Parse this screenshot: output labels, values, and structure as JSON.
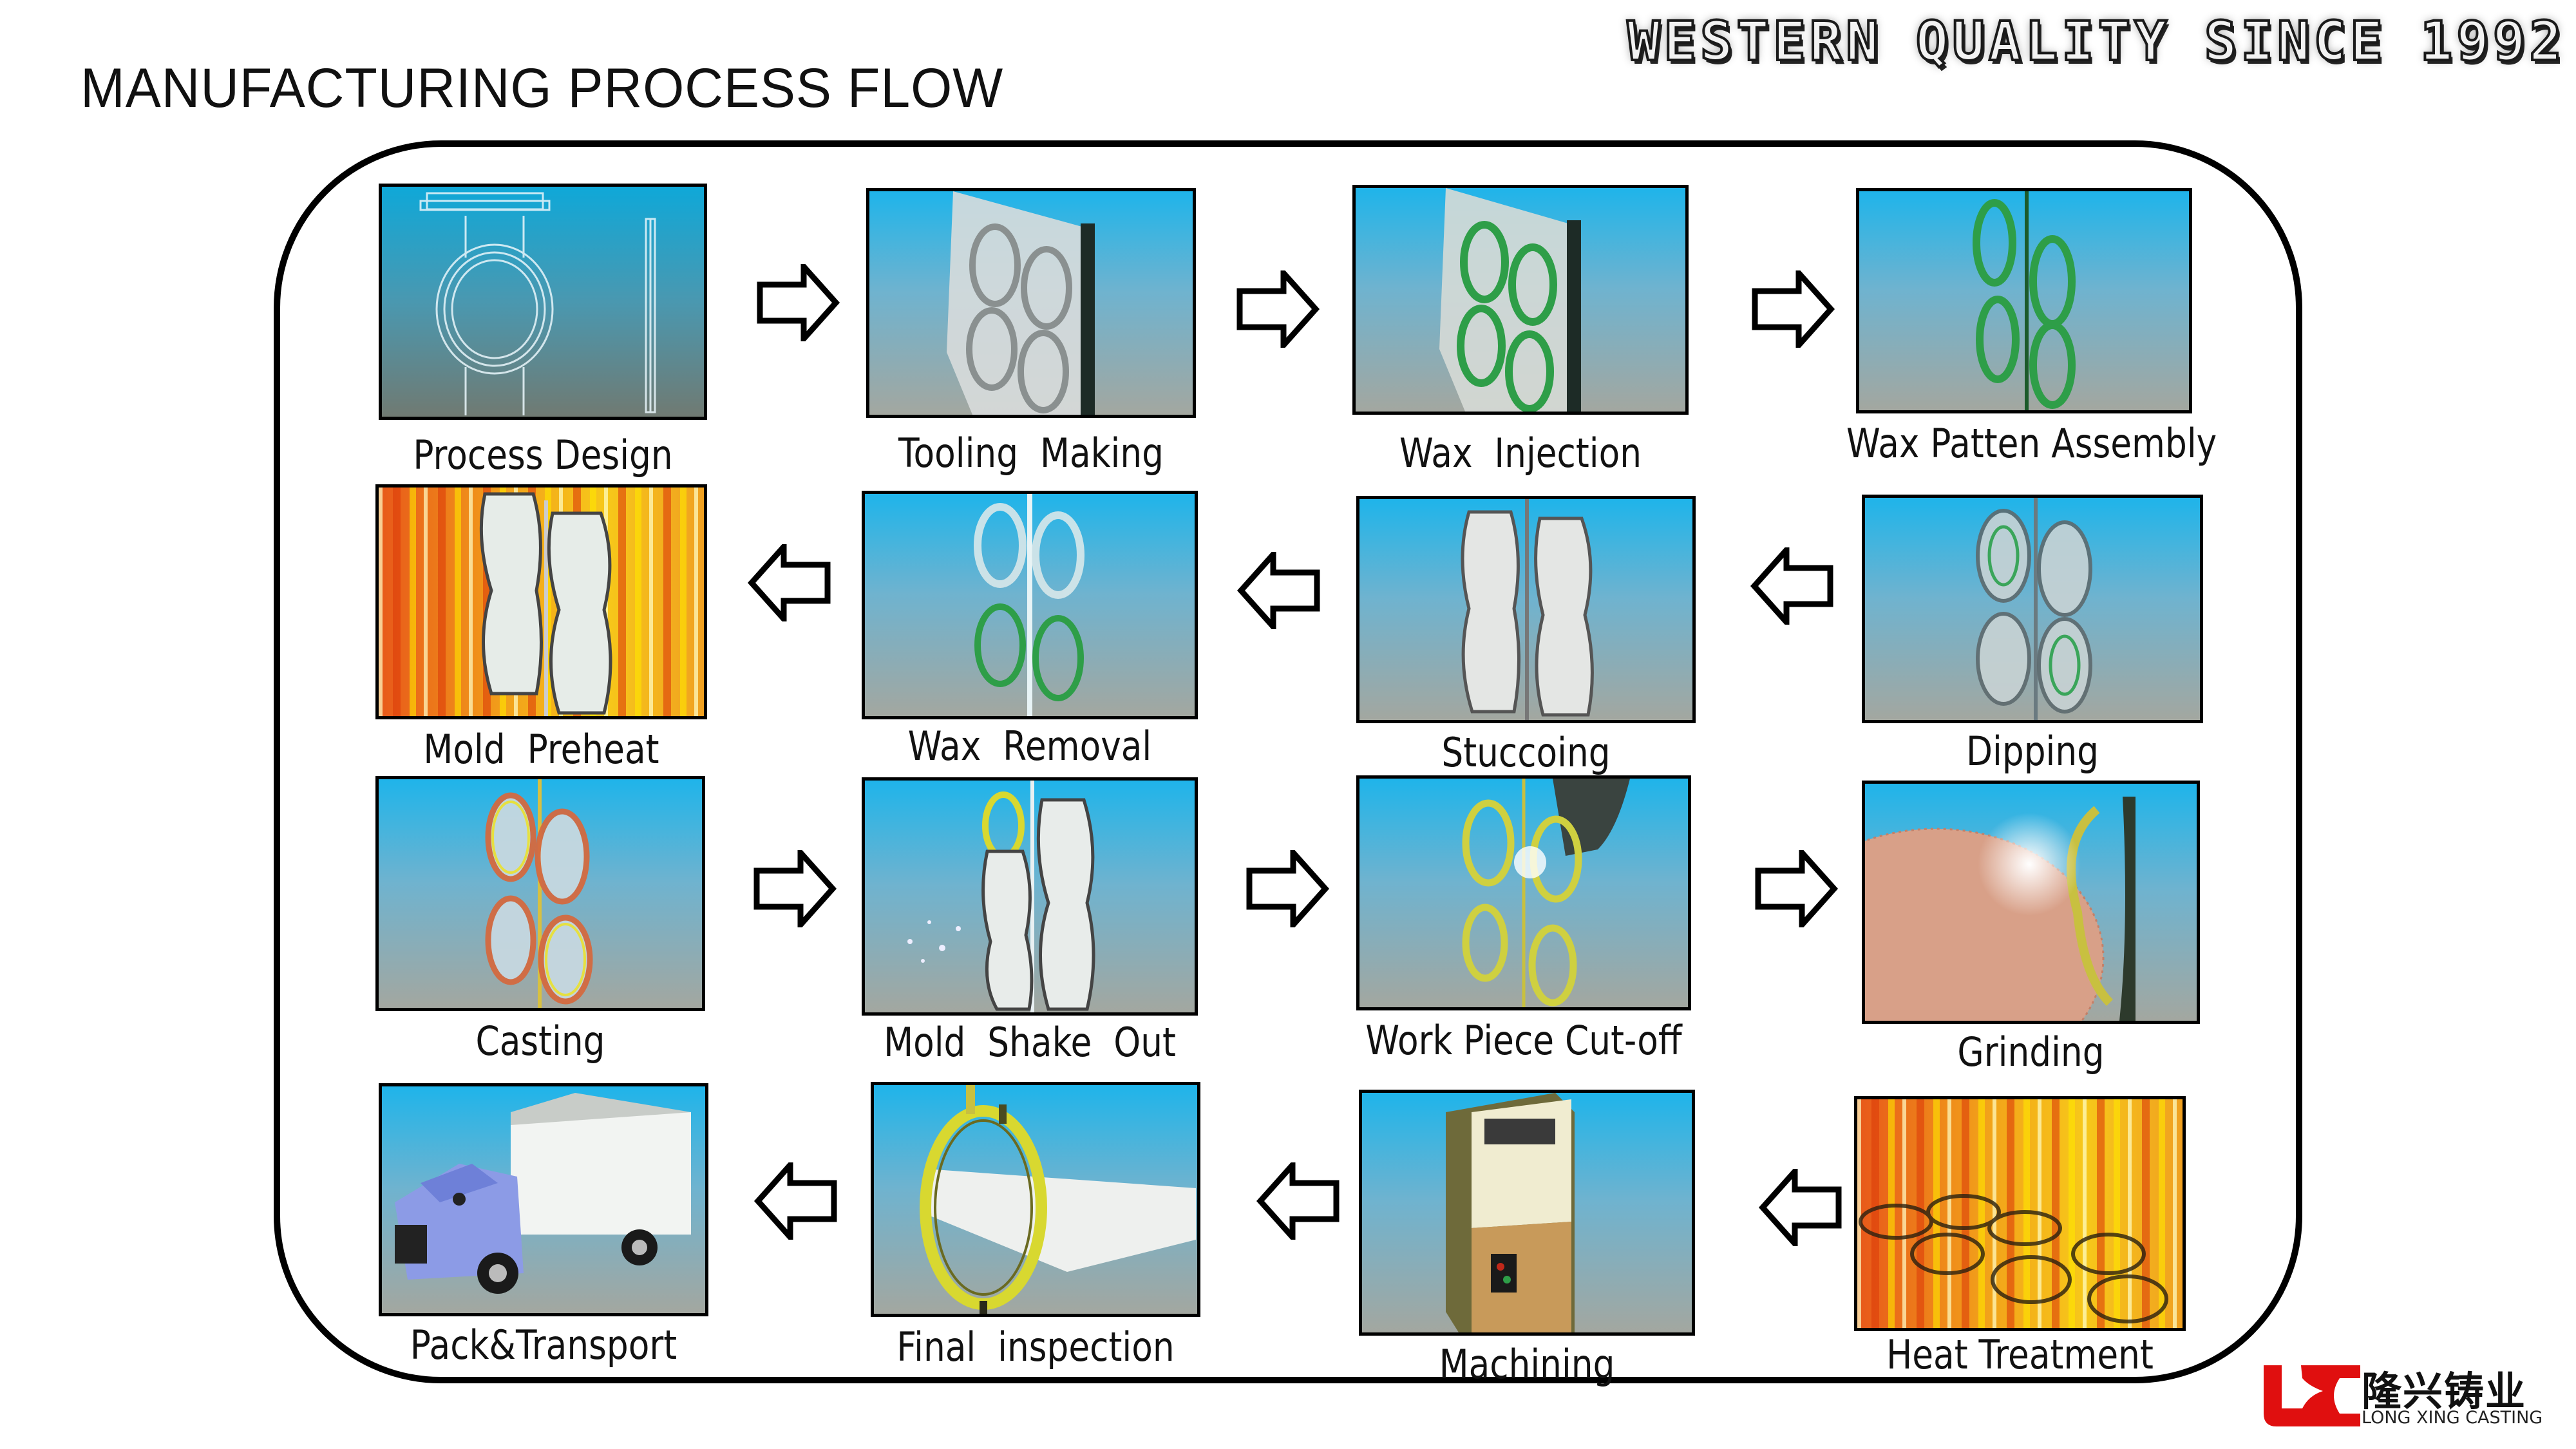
{
  "header": {
    "title": "MANUFACTURING PROCESS FLOW",
    "slogan": [
      "WESTERN",
      "QUALITY",
      "SINCE",
      "1992"
    ]
  },
  "steps": [
    {
      "label": "Process Design",
      "scene": "blueprint"
    },
    {
      "label": "Tooling  Making",
      "scene": "mold-plate"
    },
    {
      "label": "Wax  Injection",
      "scene": "mold-plate-green-rings"
    },
    {
      "label": "Wax Patten Assembly",
      "scene": "green-wax-tree"
    },
    {
      "label": "Dipping",
      "scene": "coated-tree"
    },
    {
      "label": "Stuccoing",
      "scene": "stucco-tree"
    },
    {
      "label": "Wax  Removal",
      "scene": "shell-tree"
    },
    {
      "label": "Mold  Preheat",
      "scene": "shell-in-fire"
    },
    {
      "label": "Casting",
      "scene": "metal-filled-shell"
    },
    {
      "label": "Mold  Shake  Out",
      "scene": "shell-breaking"
    },
    {
      "label": "Work Piece Cut-off",
      "scene": "cutting-rings"
    },
    {
      "label": "Grinding",
      "scene": "grinding-wheel"
    },
    {
      "label": "Heat Treatment",
      "scene": "parts-in-furnace"
    },
    {
      "label": "Machining",
      "scene": "cnc-machine"
    },
    {
      "label": "Final  inspection",
      "scene": "finished-part"
    },
    {
      "label": "Pack&Transport",
      "scene": "delivery-truck"
    }
  ],
  "flow_arrows": [
    {
      "from": "Process Design",
      "to": "Tooling  Making",
      "direction": "right"
    },
    {
      "from": "Tooling  Making",
      "to": "Wax  Injection",
      "direction": "right"
    },
    {
      "from": "Wax  Injection",
      "to": "Wax Patten Assembly",
      "direction": "right"
    },
    {
      "from": "Dipping",
      "to": "Stuccoing",
      "direction": "left"
    },
    {
      "from": "Stuccoing",
      "to": "Wax  Removal",
      "direction": "left"
    },
    {
      "from": "Wax  Removal",
      "to": "Mold  Preheat",
      "direction": "left"
    },
    {
      "from": "Casting",
      "to": "Mold  Shake  Out",
      "direction": "right"
    },
    {
      "from": "Mold  Shake  Out",
      "to": "Work Piece Cut-off",
      "direction": "right"
    },
    {
      "from": "Work Piece Cut-off",
      "to": "Grinding",
      "direction": "right"
    },
    {
      "from": "Heat Treatment",
      "to": "Machining",
      "direction": "left"
    },
    {
      "from": "Machining",
      "to": "Final  inspection",
      "direction": "left"
    },
    {
      "from": "Final  inspection",
      "to": "Pack&Transport",
      "direction": "left"
    }
  ],
  "logo": {
    "chinese_name": "隆兴铸业",
    "english_name": "LONG XING CASTING",
    "brand_color": "#e00f0f"
  },
  "colors": {
    "frame": "#000000",
    "sky_top": "#1fb4ea",
    "ground": "#a3a7a0",
    "fire": "#f2a21a"
  }
}
